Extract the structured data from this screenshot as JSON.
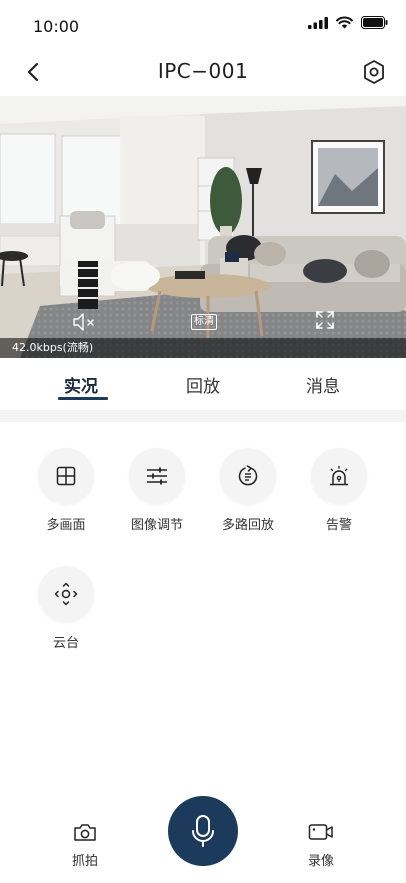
{
  "status_bar": {
    "time": "10:00"
  },
  "nav": {
    "title": "IPC−001"
  },
  "video": {
    "bitrate": "42.0kbps(流畅)",
    "quality_label": "标清"
  },
  "tabs": [
    {
      "label": "实况",
      "active": true
    },
    {
      "label": "回放",
      "active": false
    },
    {
      "label": "消息",
      "active": false
    }
  ],
  "functions": [
    {
      "label": "多画面",
      "icon": "grid-icon"
    },
    {
      "label": "图像调节",
      "icon": "sliders-icon"
    },
    {
      "label": "多路回放",
      "icon": "replay-icon"
    },
    {
      "label": "告警",
      "icon": "alarm-icon"
    },
    {
      "label": "云台",
      "icon": "ptz-icon"
    }
  ],
  "bottom_bar": {
    "snapshot_label": "抓拍",
    "record_label": "录像"
  },
  "colors": {
    "accent": "#1b3a5c"
  }
}
